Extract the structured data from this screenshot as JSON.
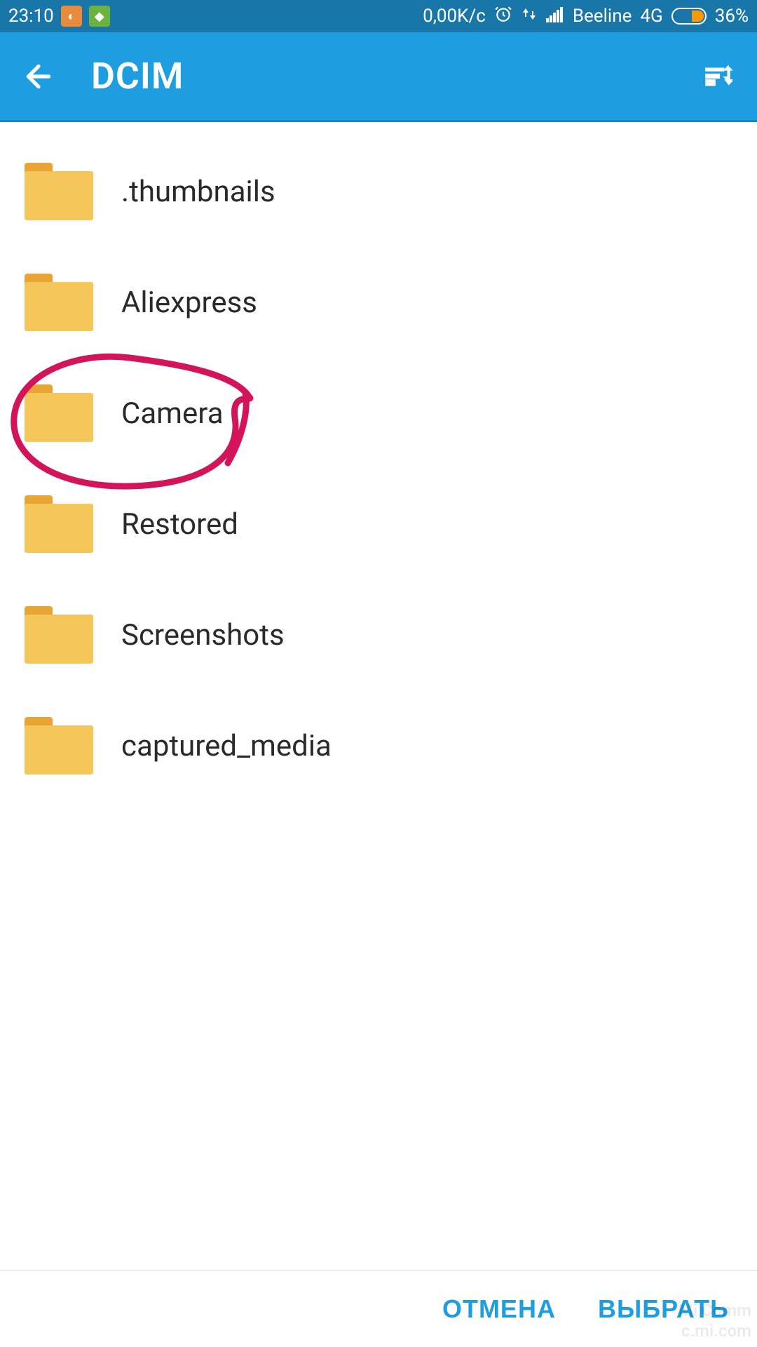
{
  "statusBar": {
    "time": "23:10",
    "dataRate": "0,00K/c",
    "carrier": "Beeline",
    "network": "4G",
    "batteryPercent": "36%"
  },
  "appBar": {
    "title": "DCIM"
  },
  "folders": [
    {
      "name": ".thumbnails"
    },
    {
      "name": "Aliexpress"
    },
    {
      "name": "Camera"
    },
    {
      "name": "Restored"
    },
    {
      "name": "Screenshots"
    },
    {
      "name": "captured_media"
    }
  ],
  "bottomBar": {
    "cancel": "ОТМЕНА",
    "select": "ВЫБРАТЬ"
  },
  "annotation": {
    "highlightedFolder": "Camera",
    "color": "#d4145a"
  },
  "watermark": {
    "line1": "Mi Comm",
    "line2": "c.mi.com"
  }
}
